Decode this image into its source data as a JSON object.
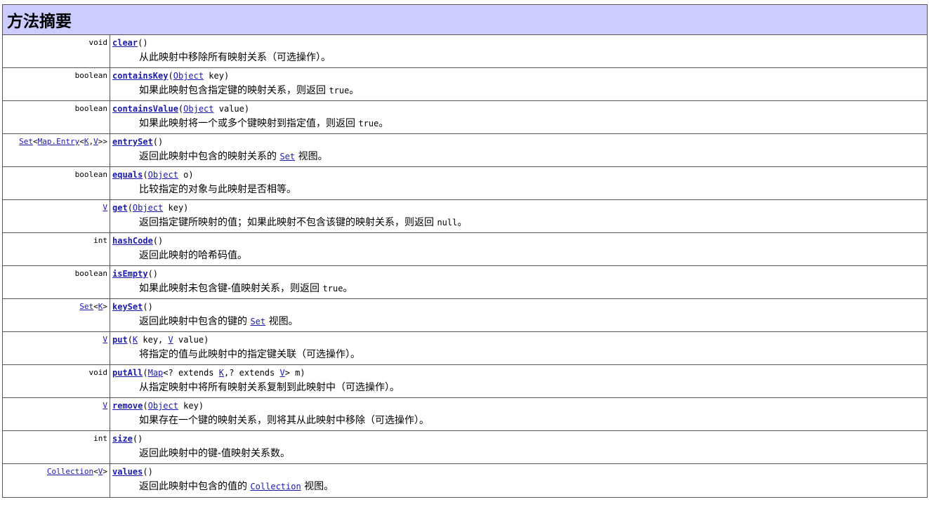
{
  "title": "方法摘要",
  "rows": [
    {
      "ret": [
        {
          "t": "void"
        }
      ],
      "sig": [
        {
          "t": "clear",
          "link": true,
          "bold": true
        },
        {
          "t": "()"
        }
      ],
      "desc": [
        {
          "t": "从此映射中移除所有映射关系（可选操作）。"
        }
      ]
    },
    {
      "ret": [
        {
          "t": "boolean"
        }
      ],
      "sig": [
        {
          "t": "containsKey",
          "link": true,
          "bold": true
        },
        {
          "t": "("
        },
        {
          "t": "Object",
          "link": true
        },
        {
          "t": " key)"
        }
      ],
      "desc": [
        {
          "t": "如果此映射包含指定键的映射关系，则返回 "
        },
        {
          "t": "true",
          "code": true
        },
        {
          "t": "。"
        }
      ]
    },
    {
      "ret": [
        {
          "t": "boolean"
        }
      ],
      "sig": [
        {
          "t": "containsValue",
          "link": true,
          "bold": true
        },
        {
          "t": "("
        },
        {
          "t": "Object",
          "link": true
        },
        {
          "t": " value)"
        }
      ],
      "desc": [
        {
          "t": "如果此映射将一个或多个键映射到指定值，则返回 "
        },
        {
          "t": "true",
          "code": true
        },
        {
          "t": "。"
        }
      ]
    },
    {
      "ret": [
        {
          "t": "Set",
          "link": true
        },
        {
          "t": "<"
        },
        {
          "t": "Map.Entry",
          "link": true
        },
        {
          "t": "<"
        },
        {
          "t": "K",
          "link": true
        },
        {
          "t": ","
        },
        {
          "t": "V",
          "link": true
        },
        {
          "t": ">>"
        }
      ],
      "sig": [
        {
          "t": "entrySet",
          "link": true,
          "bold": true
        },
        {
          "t": "()"
        }
      ],
      "desc": [
        {
          "t": "返回此映射中包含的映射关系的 "
        },
        {
          "t": "Set",
          "code": true,
          "link": true
        },
        {
          "t": " 视图。"
        }
      ]
    },
    {
      "ret": [
        {
          "t": "boolean"
        }
      ],
      "sig": [
        {
          "t": "equals",
          "link": true,
          "bold": true
        },
        {
          "t": "("
        },
        {
          "t": "Object",
          "link": true
        },
        {
          "t": " o)"
        }
      ],
      "desc": [
        {
          "t": "比较指定的对象与此映射是否相等。"
        }
      ]
    },
    {
      "ret": [
        {
          "t": "V",
          "link": true
        }
      ],
      "sig": [
        {
          "t": "get",
          "link": true,
          "bold": true
        },
        {
          "t": "("
        },
        {
          "t": "Object",
          "link": true
        },
        {
          "t": " key)"
        }
      ],
      "desc": [
        {
          "t": "返回指定键所映射的值；如果此映射不包含该键的映射关系，则返回 "
        },
        {
          "t": "null",
          "code": true
        },
        {
          "t": "。"
        }
      ]
    },
    {
      "ret": [
        {
          "t": "int"
        }
      ],
      "sig": [
        {
          "t": "hashCode",
          "link": true,
          "bold": true
        },
        {
          "t": "()"
        }
      ],
      "desc": [
        {
          "t": "返回此映射的哈希码值。"
        }
      ]
    },
    {
      "ret": [
        {
          "t": "boolean"
        }
      ],
      "sig": [
        {
          "t": "isEmpty",
          "link": true,
          "bold": true
        },
        {
          "t": "()"
        }
      ],
      "desc": [
        {
          "t": "如果此映射未包含键-值映射关系，则返回 "
        },
        {
          "t": "true",
          "code": true
        },
        {
          "t": "。"
        }
      ]
    },
    {
      "ret": [
        {
          "t": "Set",
          "link": true
        },
        {
          "t": "<"
        },
        {
          "t": "K",
          "link": true
        },
        {
          "t": ">"
        }
      ],
      "sig": [
        {
          "t": "keySet",
          "link": true,
          "bold": true
        },
        {
          "t": "()"
        }
      ],
      "desc": [
        {
          "t": "返回此映射中包含的键的 "
        },
        {
          "t": "Set",
          "code": true,
          "link": true
        },
        {
          "t": " 视图。"
        }
      ]
    },
    {
      "ret": [
        {
          "t": "V",
          "link": true
        }
      ],
      "sig": [
        {
          "t": "put",
          "link": true,
          "bold": true
        },
        {
          "t": "("
        },
        {
          "t": "K",
          "link": true
        },
        {
          "t": " key, "
        },
        {
          "t": "V",
          "link": true
        },
        {
          "t": " value)"
        }
      ],
      "desc": [
        {
          "t": "将指定的值与此映射中的指定键关联（可选操作）。"
        }
      ]
    },
    {
      "ret": [
        {
          "t": "void"
        }
      ],
      "sig": [
        {
          "t": "putAll",
          "link": true,
          "bold": true
        },
        {
          "t": "("
        },
        {
          "t": "Map",
          "link": true
        },
        {
          "t": "<? extends "
        },
        {
          "t": "K",
          "link": true
        },
        {
          "t": ",? extends "
        },
        {
          "t": "V",
          "link": true
        },
        {
          "t": "> m)"
        }
      ],
      "desc": [
        {
          "t": "从指定映射中将所有映射关系复制到此映射中（可选操作）。"
        }
      ]
    },
    {
      "ret": [
        {
          "t": "V",
          "link": true
        }
      ],
      "sig": [
        {
          "t": "remove",
          "link": true,
          "bold": true
        },
        {
          "t": "("
        },
        {
          "t": "Object",
          "link": true
        },
        {
          "t": " key)"
        }
      ],
      "desc": [
        {
          "t": "如果存在一个键的映射关系，则将其从此映射中移除（可选操作）。"
        }
      ]
    },
    {
      "ret": [
        {
          "t": "int"
        }
      ],
      "sig": [
        {
          "t": "size",
          "link": true,
          "bold": true
        },
        {
          "t": "()"
        }
      ],
      "desc": [
        {
          "t": "返回此映射中的键-值映射关系数。"
        }
      ]
    },
    {
      "ret": [
        {
          "t": "Collection",
          "link": true
        },
        {
          "t": "<"
        },
        {
          "t": "V",
          "link": true
        },
        {
          "t": ">"
        }
      ],
      "sig": [
        {
          "t": "values",
          "link": true,
          "bold": true
        },
        {
          "t": "()"
        }
      ],
      "desc": [
        {
          "t": "返回此映射中包含的值的 "
        },
        {
          "t": "Collection",
          "code": true,
          "link": true
        },
        {
          "t": " 视图。"
        }
      ]
    }
  ]
}
